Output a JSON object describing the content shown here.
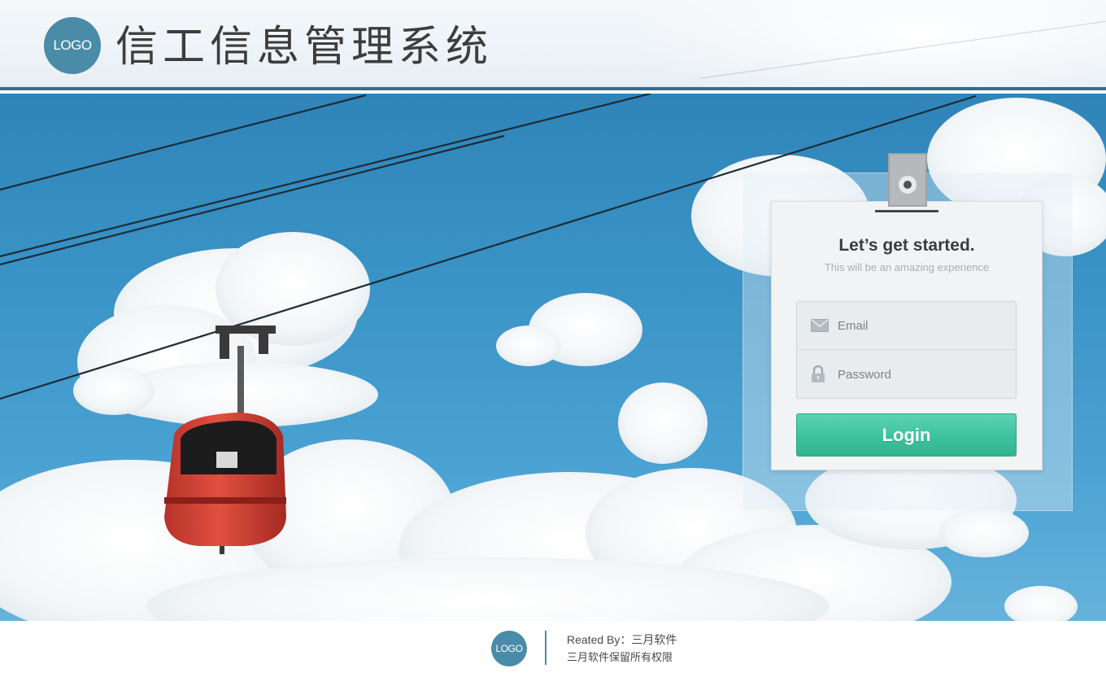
{
  "header": {
    "logo_text": "LOGO",
    "title": "信工信息管理系统"
  },
  "hero": {
    "image_content": "cable-car"
  },
  "login_card": {
    "title": "Let’s get started.",
    "subtitle": "This will be an amazing experience",
    "email_placeholder": "Email",
    "password_placeholder": "Password",
    "login_label": "Login",
    "icons": [
      "clip-icon",
      "envelope-icon",
      "lock-icon"
    ]
  },
  "footer": {
    "logo_text": "LOGO",
    "credit": "Reated By：三月软件",
    "copyright": "三月软件保留所有权限"
  },
  "colors": {
    "accent": "#2f6e8e",
    "logo_badge": "#4a8ba8",
    "login_button": "#3cc39c"
  }
}
